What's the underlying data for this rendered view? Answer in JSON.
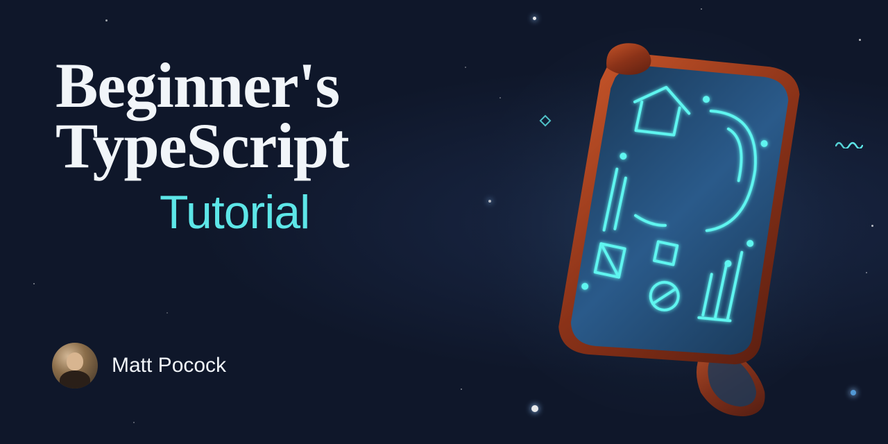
{
  "title_line1": "Beginner's",
  "title_line2": "TypeScript",
  "subtitle": "Tutorial",
  "author": {
    "name": "Matt Pocock"
  },
  "colors": {
    "background": "#0f172a",
    "title": "#f1f5f9",
    "accent": "#5de6e8"
  }
}
